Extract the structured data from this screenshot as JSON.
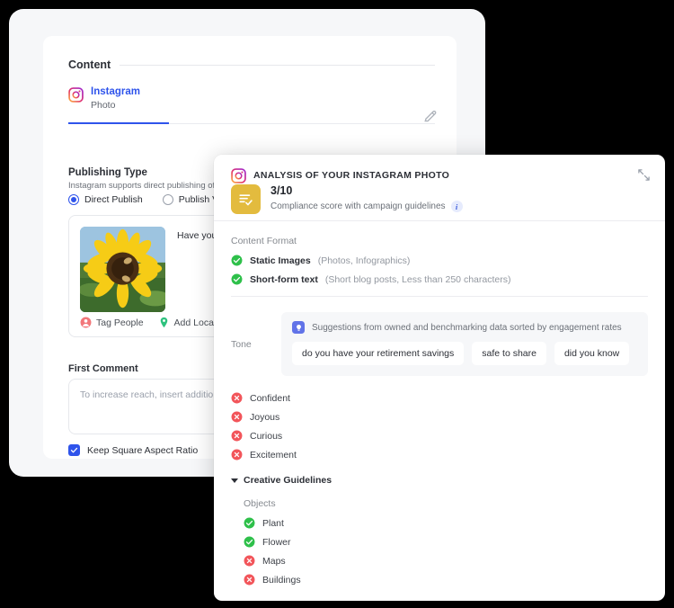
{
  "editor": {
    "content_label": "Content",
    "tab": {
      "network": "Instagram",
      "type": "Photo",
      "icon": "instagram-icon"
    },
    "edit_icon": "pencil-icon",
    "publishing": {
      "title": "Publishing Type",
      "subtitle": "Instagram supports direct publishing of photos/videos only through Business accounts.",
      "options": [
        {
          "label": "Direct Publish",
          "selected": true
        },
        {
          "label": "Publish Via Mobile",
          "selected": false
        }
      ]
    },
    "preview": {
      "post_text": "Have you gotten help to get you m",
      "thumbnail_alt": "sunflower-photo",
      "actions": [
        {
          "label": "Tag People",
          "icon": "tag-people-icon",
          "color": "#f2777a"
        },
        {
          "label": "Add Location",
          "icon": "location-pin-icon",
          "color": "#2ec27e"
        },
        {
          "label": "",
          "icon": "shopping-bag-icon",
          "color": "#6030e8"
        }
      ]
    },
    "first_comment": {
      "title": "First Comment",
      "placeholder": "To increase reach, insert additional hash"
    },
    "keep_square": {
      "label": "Keep Square Aspect Ratio",
      "checked": true
    }
  },
  "panel": {
    "header": {
      "icon": "instagram-icon",
      "title": "ANALYSIS OF YOUR INSTAGRAM PHOTO",
      "collapse_icon": "collapse-diagonal-icon"
    },
    "score": {
      "icon": "checklist-icon",
      "value": "3/10",
      "caption": "Compliance score with campaign guidelines",
      "info_icon": "info-icon",
      "badge_color": "#e3bb3e"
    },
    "content_format": {
      "label": "Content Format",
      "items": [
        {
          "status": "pass",
          "name": "Static Images",
          "note": "(Photos, Infographics)"
        },
        {
          "status": "pass",
          "name": "Short-form text",
          "note": "(Short blog posts, Less than 250 characters)"
        }
      ]
    },
    "tone": {
      "label": "Tone",
      "hint_icon": "lightbulb-icon",
      "hint": "Suggestions from owned and benchmarking data sorted by engagement rates",
      "chips": [
        "do you have your retirement savings",
        "safe to share",
        "did you know"
      ],
      "items": [
        {
          "status": "fail",
          "name": "Confident"
        },
        {
          "status": "fail",
          "name": "Joyous"
        },
        {
          "status": "fail",
          "name": "Curious"
        },
        {
          "status": "fail",
          "name": "Excitement"
        }
      ]
    },
    "creative_guidelines": {
      "label": "Creative Guidelines",
      "expanded": true,
      "objects": {
        "label": "Objects",
        "items": [
          {
            "status": "pass",
            "name": "Plant"
          },
          {
            "status": "pass",
            "name": "Flower"
          },
          {
            "status": "fail",
            "name": "Maps"
          },
          {
            "status": "fail",
            "name": "Buildings"
          }
        ]
      }
    }
  },
  "colors": {
    "pass": "#2ec04a",
    "fail": "#f2555a",
    "accent": "#2f54eb",
    "score": "#e3bb3e"
  }
}
